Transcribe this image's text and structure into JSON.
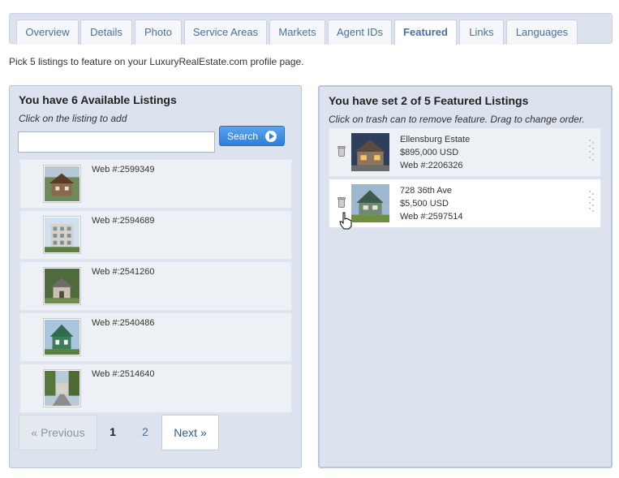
{
  "tabs": [
    {
      "label": "Overview",
      "active": false
    },
    {
      "label": "Details",
      "active": false
    },
    {
      "label": "Photo",
      "active": false
    },
    {
      "label": "Service Areas",
      "active": false
    },
    {
      "label": "Markets",
      "active": false
    },
    {
      "label": "Agent IDs",
      "active": false
    },
    {
      "label": "Featured",
      "active": true
    },
    {
      "label": "Links",
      "active": false
    },
    {
      "label": "Languages",
      "active": false
    }
  ],
  "intro": "Pick 5 listings to feature on your LuxuryRealEstate.com profile page.",
  "available": {
    "title": "You have 6 Available Listings",
    "subtitle": "Click on the listing to add",
    "search": {
      "value": "",
      "placeholder": "",
      "button_label": "Search"
    },
    "listings": [
      {
        "web": "Web #:2599349",
        "thumb": "house-photo"
      },
      {
        "web": "Web #:2594689",
        "thumb": "building-photo"
      },
      {
        "web": "Web #:2541260",
        "thumb": "house-photo"
      },
      {
        "web": "Web #:2540486",
        "thumb": "house-photo"
      },
      {
        "web": "Web #:2514640",
        "thumb": "street-photo"
      }
    ],
    "pagination": {
      "prev": "« Previous",
      "pages": [
        "1",
        "2"
      ],
      "current": "1",
      "next": "Next »"
    }
  },
  "featured": {
    "title": "You have set 2 of 5 Featured Listings",
    "subtitle": "Click on trash can to remove feature. Drag to change order.",
    "listings": [
      {
        "name": "Ellensburg Estate",
        "price": "$895,000 USD",
        "web": "Web #:2206326"
      },
      {
        "name": "728 36th Ave",
        "price": "$5,500 USD",
        "web": "Web #:2597514"
      }
    ]
  },
  "colors": {
    "accent": "#2f7fd9",
    "panel_bg": "#dce3ee",
    "tab_text": "#4a6fa0"
  }
}
